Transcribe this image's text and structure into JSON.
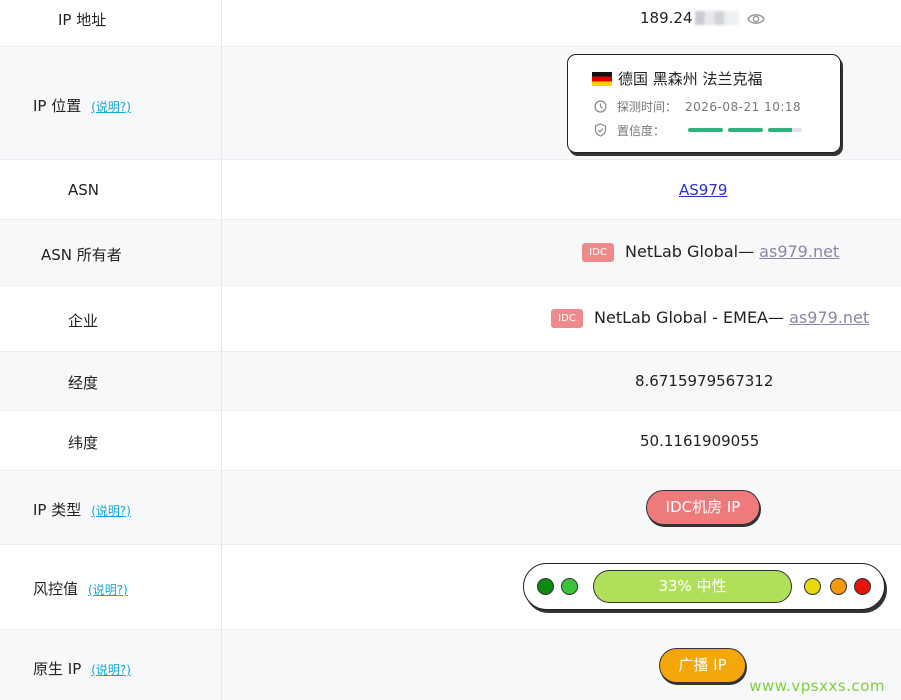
{
  "rows": {
    "ip_address": {
      "label": "IP 地址",
      "value": "189.24"
    },
    "ip_location": {
      "label": "IP 位置",
      "help": "(说明?)",
      "location": "德国 黑森州 法兰克福",
      "probe_label": "探测时间：",
      "probe_time": "2026-08-21 10:18",
      "confidence_label": "置信度：",
      "confidence_level": 0.75
    },
    "asn": {
      "label": "ASN",
      "value": "AS979"
    },
    "asn_owner": {
      "label": "ASN 所有者",
      "badge": "IDC",
      "name": "NetLab Global— ",
      "link": "as979.net"
    },
    "enterprise": {
      "label": "企业",
      "badge": "IDC",
      "name": "NetLab Global - EMEA— ",
      "link": "as979.net"
    },
    "longitude": {
      "label": "经度",
      "value": "8.6715979567312"
    },
    "latitude": {
      "label": "纬度",
      "value": "50.1161909055"
    },
    "ip_type": {
      "label": "IP 类型",
      "help": "(说明?)",
      "value": "IDC机房 IP"
    },
    "risk": {
      "label": "风控值",
      "help": "(说明?)",
      "value": "33%  中性",
      "dots_left": [
        "#0b8a12",
        "#3bc43b"
      ],
      "dots_right": [
        "#e7d80a",
        "#f29a0b",
        "#e8120c"
      ]
    },
    "native_ip": {
      "label": "原生 IP",
      "help": "(说明?)",
      "value": "广播 IP"
    }
  },
  "colors": {
    "accent": "#1aa7d6",
    "idc_badge": "#ef8a8a",
    "idc_pill": "#ef7a7c",
    "risk_bar": "#b0df5a",
    "broadcast_pill": "#f5a70a",
    "confidence": "#2fb37a"
  },
  "watermark": "www.vpsxxs.com"
}
